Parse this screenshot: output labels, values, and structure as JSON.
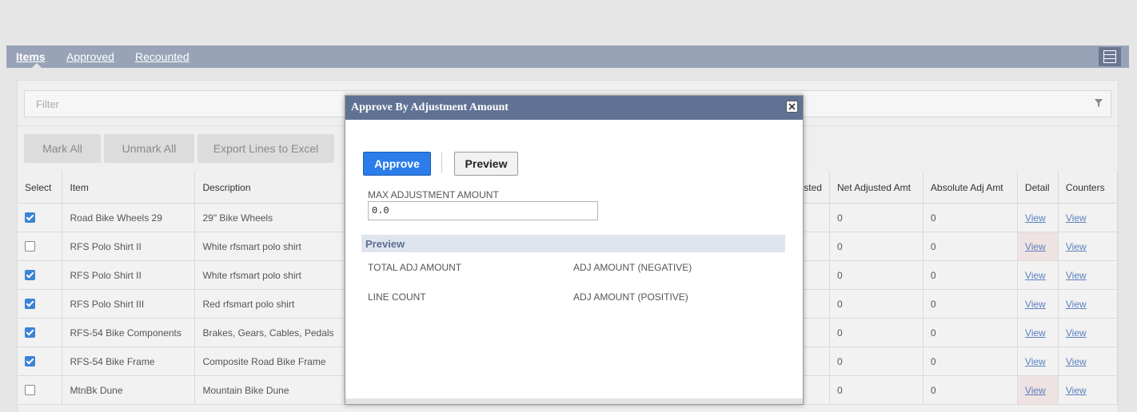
{
  "tabs": [
    {
      "label": "Items",
      "active": true
    },
    {
      "label": "Approved",
      "active": false
    },
    {
      "label": "Recounted",
      "active": false
    }
  ],
  "filter": {
    "placeholder": "Filter"
  },
  "toolbar": {
    "mark_all": "Mark All",
    "unmark_all": "Unmark All",
    "export": "Export Lines to Excel"
  },
  "table": {
    "headers": {
      "select": "Select",
      "item": "Item",
      "description": "Description",
      "adjusted_partial": "sted",
      "net_adjusted_amt": "Net Adjusted Amt",
      "absolute_adj_amt": "Absolute Adj Amt",
      "detail": "Detail",
      "counters": "Counters"
    },
    "rows": [
      {
        "checked": true,
        "item": "Road Bike Wheels 29",
        "description": "29\" Bike Wheels",
        "net": "0",
        "abs": "0",
        "detail": "View",
        "counters": "View",
        "detail_highlight": false
      },
      {
        "checked": false,
        "item": "RFS Polo Shirt II",
        "description": "White rfsmart polo shirt",
        "net": "0",
        "abs": "0",
        "detail": "View",
        "counters": "View",
        "detail_highlight": true
      },
      {
        "checked": true,
        "item": "RFS Polo Shirt II",
        "description": "White rfsmart polo shirt",
        "net": "0",
        "abs": "0",
        "detail": "View",
        "counters": "View",
        "detail_highlight": false
      },
      {
        "checked": true,
        "item": "RFS Polo Shirt III",
        "description": "Red rfsmart polo shirt",
        "net": "0",
        "abs": "0",
        "detail": "View",
        "counters": "View",
        "detail_highlight": false
      },
      {
        "checked": true,
        "item": "RFS-54 Bike Components",
        "description": "Brakes, Gears, Cables, Pedals",
        "net": "0",
        "abs": "0",
        "detail": "View",
        "counters": "View",
        "detail_highlight": false
      },
      {
        "checked": true,
        "item": "RFS-54 Bike Frame",
        "description": "Composite Road Bike Frame",
        "net": "0",
        "abs": "0",
        "detail": "View",
        "counters": "View",
        "detail_highlight": false
      },
      {
        "checked": false,
        "item": "MtnBk Dune",
        "description": "Mountain Bike Dune",
        "net": "0",
        "abs": "0",
        "detail": "View",
        "counters": "View",
        "detail_highlight": true
      }
    ]
  },
  "modal": {
    "title": "Approve By Adjustment Amount",
    "approve_label": "Approve",
    "preview_label": "Preview",
    "max_label": "MAX ADJUSTMENT AMOUNT",
    "max_value": "0.0",
    "preview_section": "Preview",
    "total_adj": "TOTAL ADJ AMOUNT",
    "adj_negative": "ADJ AMOUNT (NEGATIVE)",
    "line_count": "LINE COUNT",
    "adj_positive": "ADJ AMOUNT (POSITIVE)"
  },
  "colors": {
    "accent": "#2b7de9",
    "header": "#607294",
    "tabbar": "#98a3b7"
  },
  "icons": {
    "layout": "layout-toggle-icon",
    "filter": "filter-funnel-icon",
    "close": "close-icon"
  }
}
